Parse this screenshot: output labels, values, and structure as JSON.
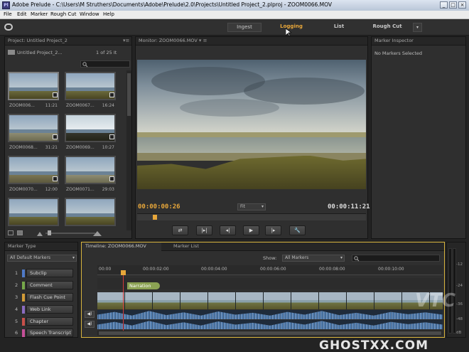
{
  "window": {
    "title": "Adobe Prelude - C:\\Users\\M Struthers\\Documents\\Adobe\\Prelude\\2.0\\Projects\\Untitled Project_2.plproj - ZOOM0066.MOV",
    "app_icon": "Pl",
    "minimize": "_",
    "maximize": "□",
    "close": "×"
  },
  "menu": [
    "File",
    "Edit",
    "Marker",
    "Rough Cut",
    "Window",
    "Help"
  ],
  "workspaces": {
    "ingest": "Ingest",
    "logging": "Logging",
    "list": "List",
    "rough_cut": "Rough Cut",
    "more": "▾",
    "accent_color": "#e8a73a"
  },
  "project": {
    "header": "Project: Untitled Project_2",
    "folder_name": "Untitled Project_2...",
    "count": "1 of 25 It",
    "clips": [
      {
        "name": "ZOOM006...",
        "duration": "11:21"
      },
      {
        "name": "ZOOM0067...",
        "duration": "16:24"
      },
      {
        "name": "ZOOM0068...",
        "duration": "31:21"
      },
      {
        "name": "ZOOM0069...",
        "duration": "10:27"
      },
      {
        "name": "ZOOM0070...",
        "duration": "12:00"
      },
      {
        "name": "ZOOM0071...",
        "duration": "29:03"
      },
      {
        "name": "",
        "duration": ""
      },
      {
        "name": "",
        "duration": ""
      }
    ]
  },
  "monitor": {
    "header": "Monitor: ZOOM0066.MOV",
    "timecode_current": "00:00:00:26",
    "timecode_duration": "00:00:11:21",
    "fit": "Fit",
    "transport": [
      "⇄",
      "|▸|",
      "◂|",
      "▶",
      "|▸",
      "🔧"
    ]
  },
  "inspector": {
    "header": "Marker Inspector",
    "status": "No Markers Selected"
  },
  "marker_type": {
    "header": "Marker Type",
    "select": "All Default Markers",
    "items": [
      {
        "num": "1",
        "label": "Subclip",
        "color": "#4f7ac7"
      },
      {
        "num": "2",
        "label": "Comment",
        "color": "#76a84a"
      },
      {
        "num": "3",
        "label": "Flash Cue Point",
        "color": "#d19b38"
      },
      {
        "num": "4",
        "label": "Web Link",
        "color": "#8a6cc0"
      },
      {
        "num": "5",
        "label": "Chapter",
        "color": "#c8504a"
      },
      {
        "num": "6",
        "label": "Speech Transcript",
        "color": "#c54f98"
      }
    ]
  },
  "timeline": {
    "tab_active": "Timeline: ZOOM0066.MOV",
    "tab_other": "Marker List",
    "show_label": "Show:",
    "show_value": "All Markers",
    "ruler": [
      "00:00",
      "00:00:02:00",
      "00:00:04:00",
      "00:00:06:00",
      "00:00:08:00",
      "00:00:10:00"
    ],
    "narration": "Narration",
    "speaker_icon": "◀)"
  },
  "meter": {
    "scale": [
      "-12",
      "-24",
      "-36",
      "-48",
      "dB"
    ]
  },
  "watermarks": {
    "vtc": "VTC",
    "ghostxx": "GHOSTXX.COM"
  }
}
